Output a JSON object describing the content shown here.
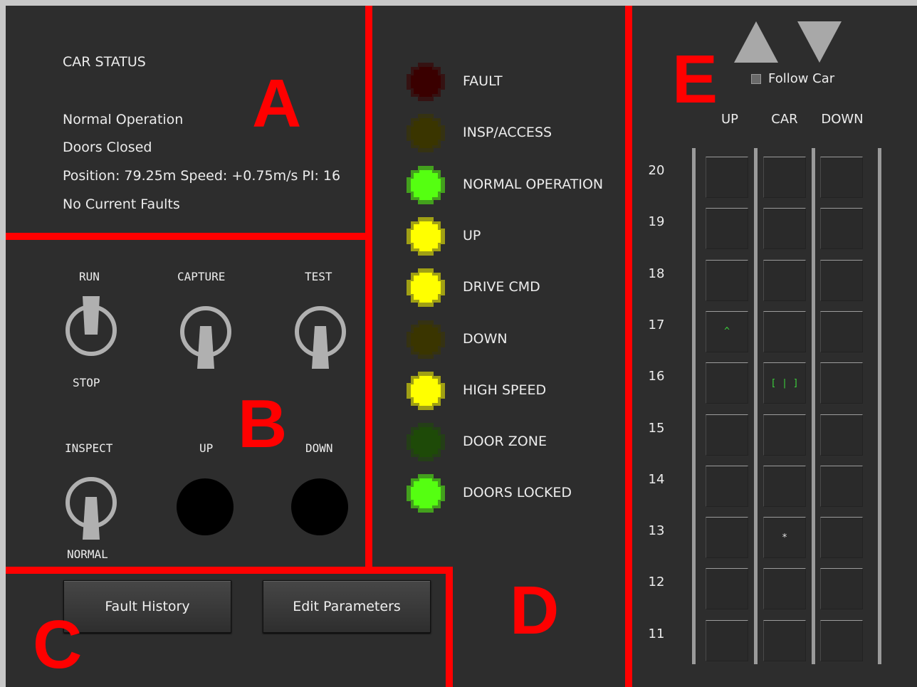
{
  "section_labels": {
    "a": "A",
    "b": "B",
    "c": "C",
    "d": "D",
    "e": "E"
  },
  "car_status": {
    "title": "CAR STATUS",
    "lines": [
      "Normal Operation",
      "Doors Closed",
      "Position: 79.25m Speed: +0.75m/s PI: 16",
      "No Current Faults"
    ]
  },
  "switches": {
    "run": {
      "top_label": "RUN",
      "bottom_label": "STOP",
      "state": "up"
    },
    "capture": {
      "top_label": "CAPTURE",
      "state": "down"
    },
    "test": {
      "top_label": "TEST",
      "state": "down"
    },
    "inspect": {
      "top_label": "INSPECT",
      "bottom_label": "NORMAL",
      "state": "down"
    }
  },
  "buttons": {
    "up_label": "UP",
    "down_label": "DOWN",
    "fault_history": "Fault History",
    "edit_parameters": "Edit Parameters"
  },
  "indicators": [
    {
      "label": "FAULT",
      "color": "#3a0000",
      "on": false
    },
    {
      "label": "INSP/ACCESS",
      "color": "#3a3500",
      "on": false
    },
    {
      "label": "NORMAL OPERATION",
      "color": "#55ff11",
      "on": true
    },
    {
      "label": "UP",
      "color": "#ffff00",
      "on": true
    },
    {
      "label": "DRIVE CMD",
      "color": "#ffff00",
      "on": true
    },
    {
      "label": "DOWN",
      "color": "#3a3500",
      "on": false
    },
    {
      "label": "HIGH SPEED",
      "color": "#ffff00",
      "on": true
    },
    {
      "label": "DOOR ZONE",
      "color": "#1e4a08",
      "on": false
    },
    {
      "label": "DOORS LOCKED",
      "color": "#55ff11",
      "on": true
    }
  ],
  "hoistway": {
    "follow_car_label": "Follow Car",
    "follow_car_checked": false,
    "columns": [
      "UP",
      "CAR",
      "DOWN"
    ],
    "floors": [
      {
        "number": "20",
        "up": "",
        "car": "",
        "down": ""
      },
      {
        "number": "19",
        "up": "",
        "car": "",
        "down": ""
      },
      {
        "number": "18",
        "up": "",
        "car": "",
        "down": ""
      },
      {
        "number": "17",
        "up": "^",
        "car": "",
        "down": ""
      },
      {
        "number": "16",
        "up": "",
        "car": "[ | ]",
        "down": ""
      },
      {
        "number": "15",
        "up": "",
        "car": "",
        "down": ""
      },
      {
        "number": "14",
        "up": "",
        "car": "",
        "down": ""
      },
      {
        "number": "13",
        "up": "",
        "car": "*",
        "down": ""
      },
      {
        "number": "12",
        "up": "",
        "car": "",
        "down": ""
      },
      {
        "number": "11",
        "up": "",
        "car": "",
        "down": ""
      }
    ],
    "marker_colors": {
      "up": "#3cd23c",
      "car_position": "#3cd23c",
      "car_call": "#e4e4e4"
    }
  }
}
